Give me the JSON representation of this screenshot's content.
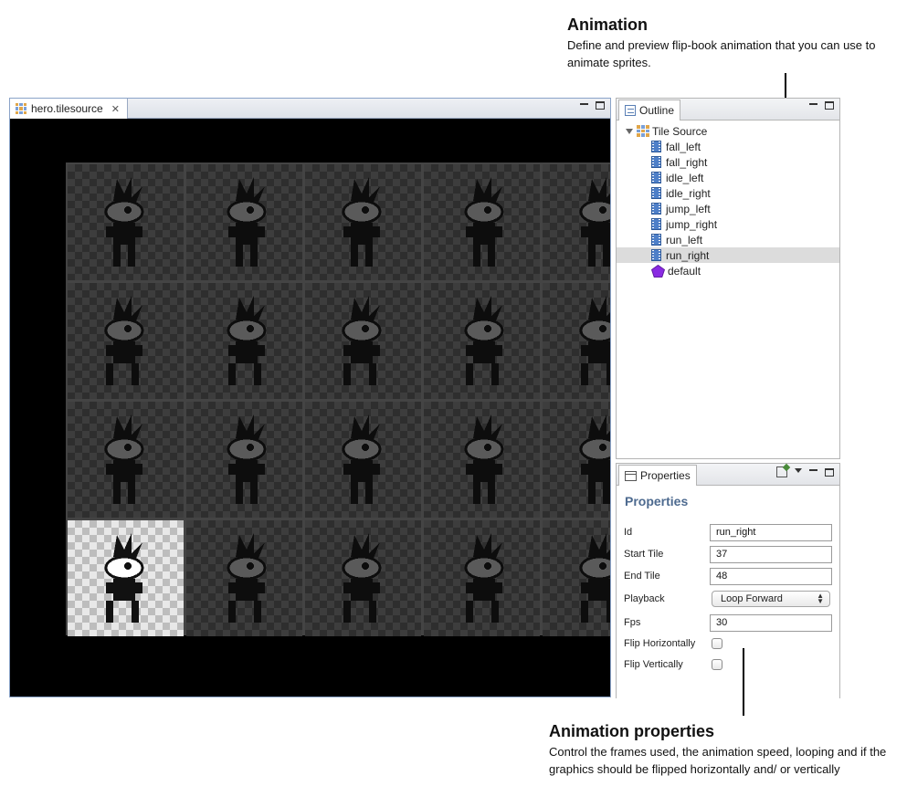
{
  "callouts": {
    "animation": {
      "title": "Animation",
      "description": "Define and preview flip-book animation that you can use to animate sprites."
    },
    "properties": {
      "title": "Animation properties",
      "description": "Control the frames used, the animation speed, looping and if the graphics should be flipped horizontally and/ or vertically"
    }
  },
  "editor": {
    "tab_label": "hero.tilesource",
    "tab_icon": "tilesource-icon",
    "close_icon": "close-icon",
    "grid": {
      "rows": 4,
      "columns": 5,
      "selected_tile": [
        3,
        0
      ]
    }
  },
  "outline": {
    "tab_label": "Outline",
    "root": {
      "label": "Tile Source",
      "icon": "tilesource-icon",
      "expanded": true
    },
    "animations": [
      {
        "label": "fall_left",
        "icon": "animation-icon"
      },
      {
        "label": "fall_right",
        "icon": "animation-icon"
      },
      {
        "label": "idle_left",
        "icon": "animation-icon"
      },
      {
        "label": "idle_right",
        "icon": "animation-icon"
      },
      {
        "label": "jump_left",
        "icon": "animation-icon"
      },
      {
        "label": "jump_right",
        "icon": "animation-icon"
      },
      {
        "label": "run_left",
        "icon": "animation-icon"
      },
      {
        "label": "run_right",
        "icon": "animation-icon",
        "selected": true
      }
    ],
    "collision_group": {
      "label": "default",
      "icon": "pentagon-icon",
      "color": "#8a2be2"
    }
  },
  "properties": {
    "tab_label": "Properties",
    "heading": "Properties",
    "heading_color": "#4d6a8f",
    "fields": {
      "id": {
        "label": "Id",
        "value": "run_right"
      },
      "start_tile": {
        "label": "Start Tile",
        "value": "37"
      },
      "end_tile": {
        "label": "End Tile",
        "value": "48"
      },
      "playback": {
        "label": "Playback",
        "value": "Loop Forward"
      },
      "fps": {
        "label": "Fps",
        "value": "30"
      },
      "flip_horizontally": {
        "label": "Flip Horizontally",
        "checked": false
      },
      "flip_vertically": {
        "label": "Flip Vertically",
        "checked": false
      }
    }
  }
}
